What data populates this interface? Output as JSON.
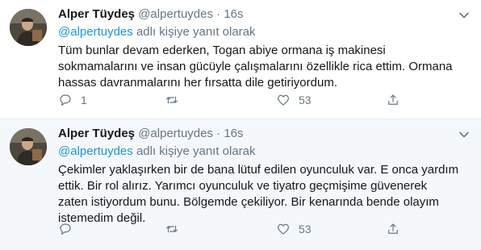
{
  "tweets": [
    {
      "author_name": "Alper Tüydeş",
      "author_handle": "@alpertuydes",
      "separator": "·",
      "time": "16s",
      "reply_mention": "@alpertuydes",
      "reply_suffix": "adlı kişiye yanıt olarak",
      "lines": [
        "Tüm bunlar devam ederken, Togan abiye ormana iş makinesi",
        "sokmamalarını ve insan gücüyle çalışmalarını özellikle rica ettim. Ormana",
        "hassas davranmalarını her fırsatta dile getiriyordum."
      ],
      "replies": "1",
      "retweets": "",
      "likes": "53"
    },
    {
      "author_name": "Alper Tüydeş",
      "author_handle": "@alpertuydes",
      "separator": "·",
      "time": "16s",
      "reply_mention": "@alpertuydes",
      "reply_suffix": "adlı kişiye yanıt olarak",
      "lines": [
        "Çekimler yaklaşırken bir de bana lütuf edilen oyunculuk var. E onca yardım",
        "ettik. Bir rol alırız. Yarımcı oyunculuk ve tiyatro geçmişime güvenerek",
        "zaten istiyordum bunu. Bölgemde çekiliyor. Bir kenarında bende olayım",
        "istemedim değil."
      ],
      "replies": "",
      "retweets": "",
      "likes": "53"
    }
  ],
  "icons": {
    "reply": "reply-icon",
    "retweet": "retweet-icon",
    "like": "heart-icon",
    "share": "share-icon",
    "more": "chevron-down-icon"
  },
  "colors": {
    "text": "#14171a",
    "muted": "#657786",
    "link": "#1b95e0",
    "hover_bg": "#f5f8fa",
    "divider": "#e6ecf0"
  }
}
